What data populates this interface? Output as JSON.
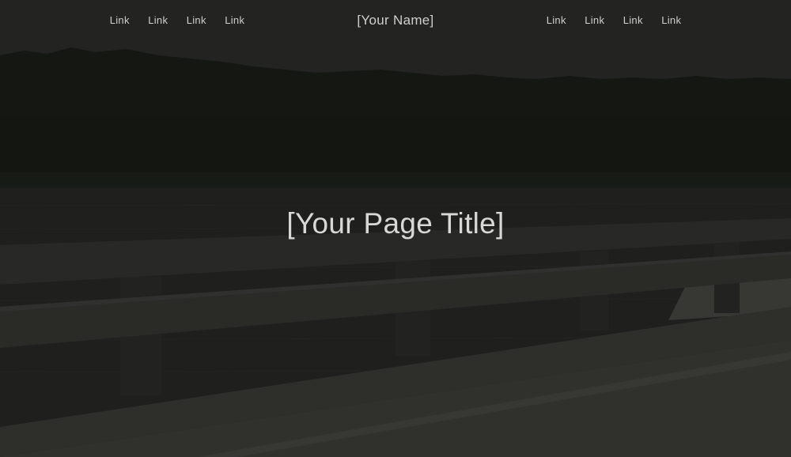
{
  "nav": {
    "left_links": [
      "Link",
      "Link",
      "Link",
      "Link"
    ],
    "brand": "[Your Name]",
    "right_links": [
      "Link",
      "Link",
      "Link",
      "Link"
    ]
  },
  "hero": {
    "title": "[Your Page Title]",
    "background_description_icon": "lake-bridge-photo"
  },
  "colors": {
    "text": "#cfcfcf",
    "overlay": "#141412"
  }
}
